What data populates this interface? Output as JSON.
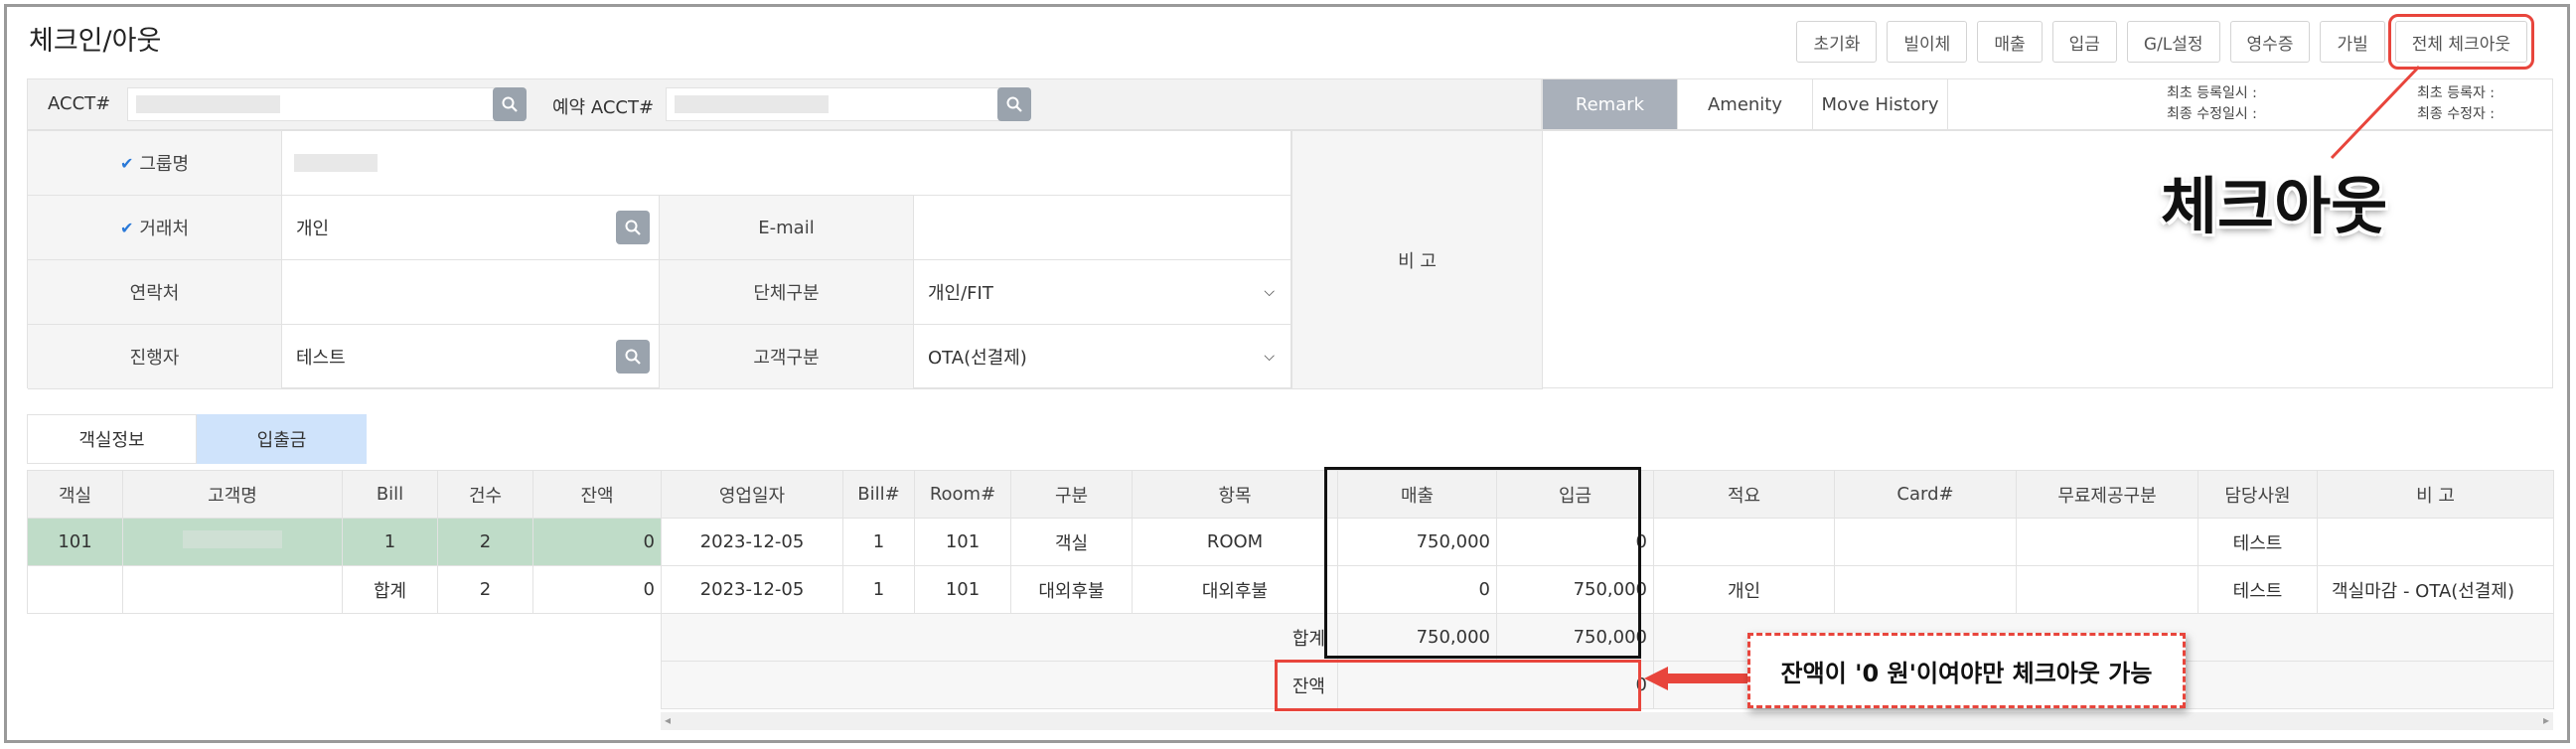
{
  "title": "체크인/아웃",
  "toolbar": [
    "초기화",
    "빌이체",
    "매출",
    "입금",
    "G/L설정",
    "영수증",
    "가빌",
    "전체 체크아웃"
  ],
  "acct": {
    "label": "ACCT#",
    "reserve_label": "예약 ACCT#"
  },
  "form": {
    "group_label": "그룹명",
    "partner_label": "거래처",
    "partner_value": "개인",
    "email_label": "E-mail",
    "contact_label": "연락처",
    "group_type_label": "단체구분",
    "group_type_value": "개인/FIT",
    "manager_label": "진행자",
    "manager_value": "테스트",
    "customer_type_label": "고객구분",
    "customer_type_value": "OTA(선결제)",
    "note_label": "비 고"
  },
  "remark_tabs": [
    "Remark",
    "Amenity",
    "Move History"
  ],
  "meta": {
    "first_reg_at": "최초 등록일시 :",
    "last_mod_at": "최종 수정일시 :",
    "first_reg_by": "최초 등록자 :",
    "last_mod_by": "최종 수정자 :"
  },
  "bottom_tabs": [
    "객실정보",
    "입출금"
  ],
  "left_table": {
    "headers": [
      "객실",
      "고객명",
      "Bill",
      "건수",
      "잔액"
    ],
    "row": {
      "room": "101",
      "bill": "1",
      "count": "2",
      "balance": "0"
    },
    "total": {
      "label": "합계",
      "count": "2",
      "balance": "0"
    }
  },
  "right_table": {
    "headers": [
      "영업일자",
      "Bill#",
      "Room#",
      "구분",
      "항목",
      "매출",
      "입금",
      "적요",
      "Card#",
      "무료제공구분",
      "담당사원",
      "비 고"
    ],
    "rows": [
      [
        "2023-12-05",
        "1",
        "101",
        "객실",
        "ROOM",
        "750,000",
        "0",
        "",
        "",
        "",
        "테스트",
        ""
      ],
      [
        "2023-12-05",
        "1",
        "101",
        "대외후불",
        "대외후불",
        "0",
        "750,000",
        "개인",
        "",
        "",
        "테스트",
        "객실마감 - OTA(선결제)"
      ]
    ],
    "total_label": "합계",
    "total_sales": "750,000",
    "total_deposit": "750,000",
    "balance_label": "잔액",
    "balance_value": "0"
  },
  "annotations": {
    "checkout": "체크아웃",
    "note": "잔액이 '0 원'이여야만 체크아웃 가능"
  },
  "colors": {
    "highlight": "#e8453c",
    "selected_row": "#bfdcc8",
    "active_tab": "#cfe3fb"
  }
}
